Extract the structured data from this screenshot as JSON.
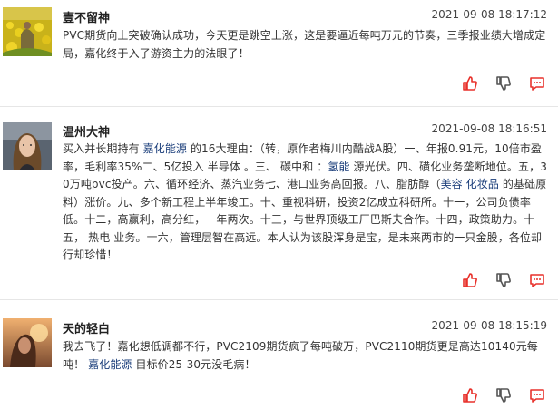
{
  "posts": [
    {
      "author": "壹不留神",
      "time": "2021-09-08 18:17:12",
      "content": "PVC期货向上突破确认成功，今天更是跳空上涨，这是要逼近每吨万元的节奏，三季报业绩大增成定局，嘉化终于入了游资主力的法眼了！",
      "avatar": "yellow-flower-field-photo"
    },
    {
      "author": "温州大神",
      "time": "2021-09-08 18:16:51",
      "content_parts": [
        "买入并长期持有 ",
        "嘉化能源",
        " 的16大理由：（转，原作者梅川内酷战A股）一、年报0.91元，10倍市盈率，毛利率35%二、5亿投入 半导体 。三、 碳中和 ：",
        "氢能",
        " 源光伏。四、磺化业务垄断地位。五，30万吨pvc投产。六、循环经济、蒸汽业务七、港口业务高回报。八、脂肪醇（",
        "美容 化妆品",
        " 的基础原料）涨价。九、多个新工程上半年竣工。十、重视科研，投资2亿成立科研所。十一，公司负债率低。十二，高赢利，高分红，一年两次。十三，与世界顶级工厂巴斯夫合作。十四，政策助力。十五， 热电 业务。十六，管理层智在高远。本人认为该股浑身是宝，是未来两市的一只金股，各位却行却珍惜！"
      ],
      "avatar": "woman-portrait-photo"
    },
    {
      "author": "天的轻白",
      "time": "2021-09-08 18:15:19",
      "content_parts": [
        "我去飞了！嘉化想低调都不行，PVC2109期货疯了每吨破万，PVC2110期货更是高达10140元每吨！ ",
        "嘉化能源",
        " 目标价25-30元没毛病！"
      ],
      "avatar": "sunset-portrait-photo"
    }
  ],
  "icons": {
    "like": "thumbs-up-icon",
    "dislike": "thumbs-down-icon",
    "reply": "comment-icon"
  },
  "colors": {
    "icon": "#e8312b",
    "link": "#1a3d7a",
    "divider": "#e6e6e6"
  }
}
